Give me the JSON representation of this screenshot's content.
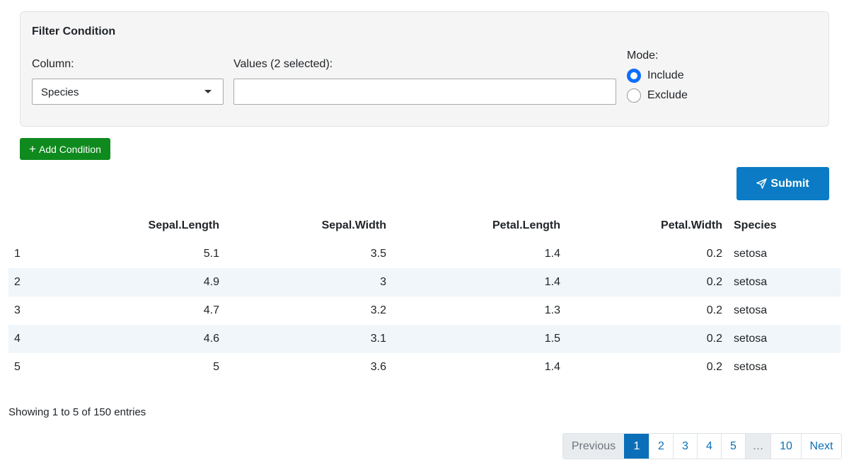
{
  "filter": {
    "title": "Filter Condition",
    "column_label": "Column:",
    "column_value": "Species",
    "values_label": "Values (2 selected):",
    "values_input": "",
    "mode_label": "Mode:",
    "mode_options": [
      "Include",
      "Exclude"
    ],
    "mode_selected": "Include"
  },
  "actions": {
    "add_condition": "Add Condition",
    "submit": "Submit"
  },
  "table": {
    "columns": [
      "",
      "Sepal.Length",
      "Sepal.Width",
      "Petal.Length",
      "Petal.Width",
      "Species"
    ],
    "rows": [
      [
        "1",
        "5.1",
        "3.5",
        "1.4",
        "0.2",
        "setosa"
      ],
      [
        "2",
        "4.9",
        "3",
        "1.4",
        "0.2",
        "setosa"
      ],
      [
        "3",
        "4.7",
        "3.2",
        "1.3",
        "0.2",
        "setosa"
      ],
      [
        "4",
        "4.6",
        "3.1",
        "1.5",
        "0.2",
        "setosa"
      ],
      [
        "5",
        "5",
        "3.6",
        "1.4",
        "0.2",
        "setosa"
      ]
    ]
  },
  "info": "Showing 1 to 5 of 150 entries",
  "pagination": {
    "previous": "Previous",
    "pages": [
      "1",
      "2",
      "3",
      "4",
      "5",
      "…",
      "10"
    ],
    "active": "1",
    "next": "Next"
  },
  "colors": {
    "add_button": "#0f8a1e",
    "submit_button": "#0a7bc4",
    "radio_checked": "#0d6efd",
    "row_stripe": "#f0f6fa"
  },
  "icons": {
    "add": "plus-icon",
    "submit": "paper-plane-icon",
    "select": "caret-down-icon"
  }
}
